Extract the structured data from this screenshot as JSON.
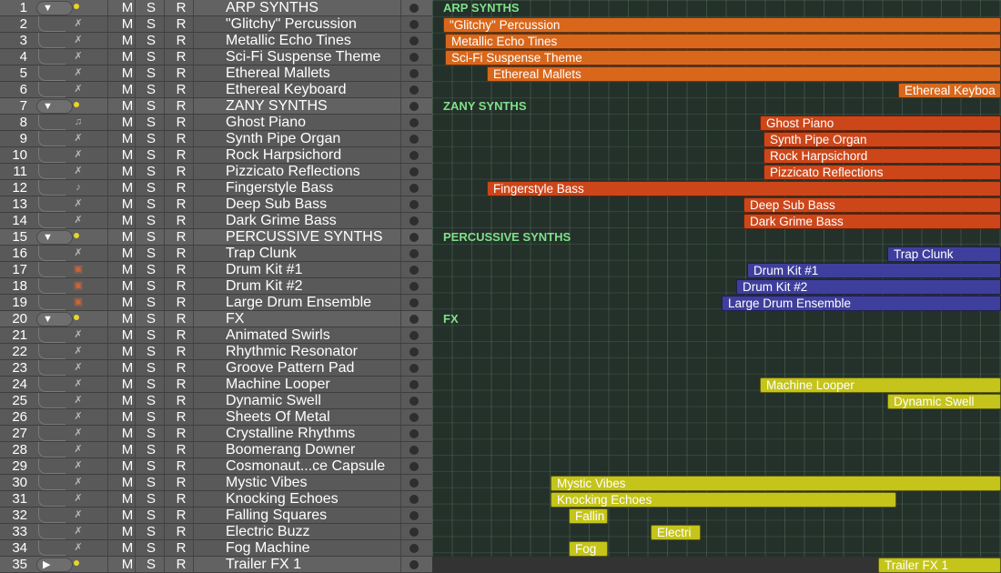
{
  "tracks": [
    {
      "num": "1",
      "name": "ARP SYNTHS",
      "folder": true,
      "expanded": true,
      "icon": "folder-icon"
    },
    {
      "num": "2",
      "name": "\"Glitchy\" Percussion",
      "icon": "synth-icon"
    },
    {
      "num": "3",
      "name": "Metallic Echo Tines",
      "icon": "synth-icon"
    },
    {
      "num": "4",
      "name": "Sci-Fi Suspense Theme",
      "icon": "synth-icon"
    },
    {
      "num": "5",
      "name": "Ethereal Mallets",
      "icon": "synth-icon"
    },
    {
      "num": "6",
      "name": "Ethereal Keyboard",
      "icon": "synth-icon"
    },
    {
      "num": "7",
      "name": "ZANY SYNTHS",
      "folder": true,
      "expanded": true,
      "icon": "folder-icon"
    },
    {
      "num": "8",
      "name": "Ghost Piano",
      "icon": "piano-icon"
    },
    {
      "num": "9",
      "name": "Synth Pipe Organ",
      "icon": "synth-icon"
    },
    {
      "num": "10",
      "name": "Rock Harpsichord",
      "icon": "synth-icon"
    },
    {
      "num": "11",
      "name": "Pizzicato Reflections",
      "icon": "synth-icon"
    },
    {
      "num": "12",
      "name": "Fingerstyle Bass",
      "icon": "guitar-icon"
    },
    {
      "num": "13",
      "name": "Deep Sub Bass",
      "icon": "synth-icon"
    },
    {
      "num": "14",
      "name": "Dark Grime Bass",
      "icon": "synth-icon"
    },
    {
      "num": "15",
      "name": "PERCUSSIVE SYNTHS",
      "folder": true,
      "expanded": true,
      "icon": "folder-icon"
    },
    {
      "num": "16",
      "name": "Trap Clunk",
      "icon": "synth-icon"
    },
    {
      "num": "17",
      "name": "Drum Kit #1",
      "icon": "drum-icon"
    },
    {
      "num": "18",
      "name": "Drum Kit #2",
      "icon": "drum-icon"
    },
    {
      "num": "19",
      "name": "Large Drum Ensemble",
      "icon": "drum-icon"
    },
    {
      "num": "20",
      "name": "FX",
      "folder": true,
      "expanded": true,
      "icon": "folder-icon"
    },
    {
      "num": "21",
      "name": "Animated Swirls",
      "icon": "synth-icon"
    },
    {
      "num": "22",
      "name": "Rhythmic Resonator",
      "icon": "synth-icon"
    },
    {
      "num": "23",
      "name": "Groove Pattern Pad",
      "icon": "synth-icon"
    },
    {
      "num": "24",
      "name": "Machine Looper",
      "icon": "synth-icon"
    },
    {
      "num": "25",
      "name": "Dynamic Swell",
      "icon": "synth-icon"
    },
    {
      "num": "26",
      "name": "Sheets Of Metal",
      "icon": "synth-icon"
    },
    {
      "num": "27",
      "name": "Crystalline Rhythms",
      "icon": "synth-icon"
    },
    {
      "num": "28",
      "name": "Boomerang Downer",
      "icon": "synth-icon"
    },
    {
      "num": "29",
      "name": "Cosmonaut...ce Capsule",
      "icon": "synth-icon"
    },
    {
      "num": "30",
      "name": "Mystic Vibes",
      "icon": "synth-icon"
    },
    {
      "num": "31",
      "name": "Knocking Echoes",
      "icon": "synth-icon"
    },
    {
      "num": "32",
      "name": "Falling Squares",
      "icon": "synth-icon"
    },
    {
      "num": "33",
      "name": "Electric Buzz",
      "icon": "synth-icon"
    },
    {
      "num": "34",
      "name": "Fog Machine",
      "icon": "synth-icon"
    },
    {
      "num": "35",
      "name": "Trailer FX 1",
      "folder": true,
      "expanded": false,
      "icon": "folder-icon"
    }
  ],
  "buttons": {
    "mute": "M",
    "solo": "S",
    "record": "R"
  },
  "groups": [
    {
      "row": 0,
      "label": "ARP SYNTHS"
    },
    {
      "row": 6,
      "label": "ZANY SYNTHS"
    },
    {
      "row": 14,
      "label": "PERCUSSIVE SYNTHS"
    },
    {
      "row": 19,
      "label": "FX"
    }
  ],
  "regions": [
    {
      "row": 1,
      "label": "\"Glitchy\" Percussion",
      "color": "orange"
    },
    {
      "row": 2,
      "label": "Metallic Echo Tines",
      "color": "orange"
    },
    {
      "row": 3,
      "label": "Sci-Fi Suspense Theme",
      "color": "orange"
    },
    {
      "row": 4,
      "label": "Ethereal Mallets",
      "color": "orange"
    },
    {
      "row": 5,
      "label": "Ethereal Keyboa",
      "color": "orange"
    },
    {
      "row": 7,
      "label": "Ghost Piano",
      "color": "red"
    },
    {
      "row": 8,
      "label": "Synth Pipe Organ",
      "color": "red"
    },
    {
      "row": 9,
      "label": "Rock Harpsichord",
      "color": "red"
    },
    {
      "row": 10,
      "label": "Pizzicato Reflections",
      "color": "red"
    },
    {
      "row": 11,
      "label": "Fingerstyle Bass",
      "color": "red"
    },
    {
      "row": 12,
      "label": "Deep Sub Bass",
      "color": "red"
    },
    {
      "row": 13,
      "label": "Dark Grime Bass",
      "color": "red"
    },
    {
      "row": 15,
      "label": "Trap Clunk",
      "color": "blue"
    },
    {
      "row": 16,
      "label": "Drum Kit #1",
      "color": "blue"
    },
    {
      "row": 17,
      "label": "Drum Kit #2",
      "color": "blue"
    },
    {
      "row": 18,
      "label": "Large Drum Ensemble",
      "color": "blue"
    },
    {
      "row": 23,
      "label": "Machine Looper",
      "color": "yellow"
    },
    {
      "row": 24,
      "label": "Dynamic Swell",
      "color": "yellow"
    },
    {
      "row": 29,
      "label": "Mystic Vibes",
      "color": "yellow"
    },
    {
      "row": 30,
      "label": "Knocking Echoes",
      "color": "yellow"
    },
    {
      "row": 31,
      "label": "Fallin",
      "color": "yellow"
    },
    {
      "row": 32,
      "label": "Electri",
      "color": "yellow"
    },
    {
      "row": 33,
      "label": "Fog",
      "color": "yellow"
    },
    {
      "row": 34,
      "label": "Trailer FX 1",
      "color": "yellow"
    }
  ],
  "colors": {
    "orange": "#d9671b",
    "red": "#cc4619",
    "blue": "#3e3f9c",
    "yellow": "#c4c41a",
    "group_label": "#7fe08a"
  }
}
